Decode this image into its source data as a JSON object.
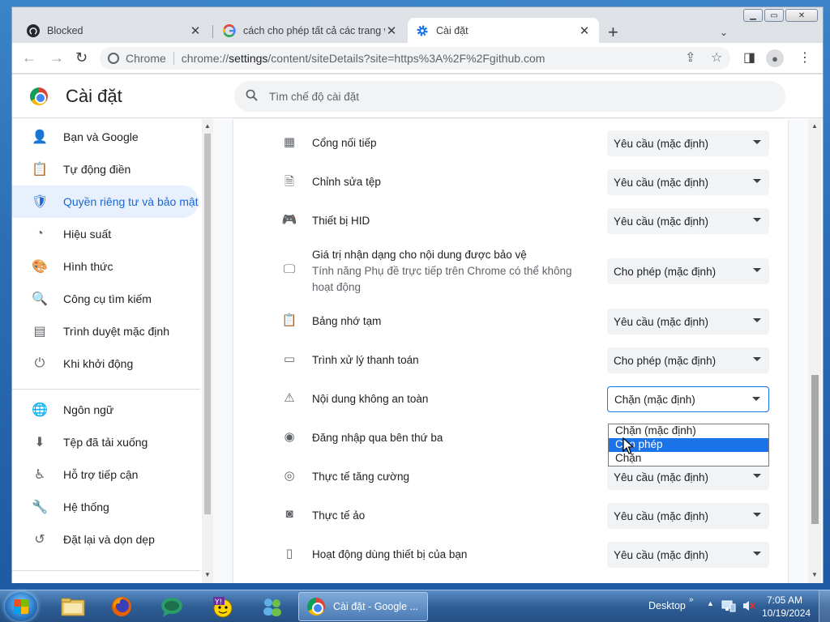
{
  "browser": {
    "tabs": [
      {
        "title": "Blocked",
        "icon": "github-icon"
      },
      {
        "title": "cách cho phép tất cả các trang w",
        "icon": "google-icon"
      },
      {
        "title": "Cài đặt",
        "icon": "settings-gear-icon"
      }
    ],
    "omnibox": {
      "site_label": "Chrome",
      "url_prefix": "chrome://",
      "url_host": "settings",
      "url_rest": "/content/siteDetails?site=https%3A%2F%2Fgithub.com"
    }
  },
  "settings": {
    "title": "Cài đặt",
    "search_placeholder": "Tìm chế độ cài đặt",
    "sidebar": [
      {
        "label": "Bạn và Google",
        "icon": "person-icon"
      },
      {
        "label": "Tự động điền",
        "icon": "clipboard-icon"
      },
      {
        "label": "Quyền riêng tư và bảo mật",
        "icon": "shield-icon",
        "active": true
      },
      {
        "label": "Hiệu suất",
        "icon": "speedometer-icon"
      },
      {
        "label": "Hình thức",
        "icon": "palette-icon"
      },
      {
        "label": "Công cụ tìm kiếm",
        "icon": "search-icon"
      },
      {
        "label": "Trình duyệt mặc định",
        "icon": "browser-icon"
      },
      {
        "label": "Khi khởi động",
        "icon": "power-icon"
      },
      {
        "label": "Ngôn ngữ",
        "icon": "globe-icon"
      },
      {
        "label": "Tệp đã tải xuống",
        "icon": "download-icon"
      },
      {
        "label": "Hỗ trợ tiếp cận",
        "icon": "accessibility-icon"
      },
      {
        "label": "Hệ thống",
        "icon": "wrench-icon"
      },
      {
        "label": "Đặt lại và dọn dẹp",
        "icon": "history-icon"
      }
    ],
    "permissions": [
      {
        "name": "Cổng nối tiếp",
        "icon": "serial-port-icon",
        "value": "Yêu cầu (mặc định)"
      },
      {
        "name": "Chỉnh sửa tệp",
        "icon": "file-edit-icon",
        "value": "Yêu cầu (mặc định)"
      },
      {
        "name": "Thiết bị HID",
        "icon": "gamepad-icon",
        "value": "Yêu cầu (mặc định)"
      },
      {
        "name": "Giá trị nhận dạng cho nội dung được bảo vệ",
        "sub": "Tính năng Phụ đề trực tiếp trên Chrome có thể không hoạt động",
        "icon": "protected-content-icon",
        "value": "Cho phép (mặc định)"
      },
      {
        "name": "Bảng nhớ tạm",
        "icon": "clipboard-icon",
        "value": "Yêu cầu (mặc định)"
      },
      {
        "name": "Trình xử lý thanh toán",
        "icon": "credit-card-icon",
        "value": "Cho phép (mặc định)"
      },
      {
        "name": "Nội dung không an toàn",
        "icon": "warning-icon",
        "value": "Chặn (mặc định)",
        "open": true
      },
      {
        "name": "Đăng nhập qua bên thứ ba",
        "icon": "account-circle-icon",
        "value": ""
      },
      {
        "name": "Thực tế tăng cường",
        "icon": "ar-goggles-icon",
        "value": "Yêu cầu (mặc định)"
      },
      {
        "name": "Thực tế ảo",
        "icon": "vr-goggles-icon",
        "value": "Yêu cầu (mặc định)"
      },
      {
        "name": "Hoạt động dùng thiết bị của bạn",
        "icon": "devices-icon",
        "value": "Yêu cầu (mặc định)"
      }
    ],
    "dropdown_options": [
      "Chặn (mặc định)",
      "Cho phép",
      "Chặn"
    ],
    "dropdown_highlighted": "Cho phép"
  },
  "taskbar": {
    "active_app": "Cài đặt - Google ...",
    "desktop_label": "Desktop",
    "time": "7:05 AM",
    "date": "10/19/2024"
  },
  "colors": {
    "accent": "#1a73e8",
    "active_nav_bg": "#e8f0fe",
    "active_nav_text": "#1967d2"
  }
}
